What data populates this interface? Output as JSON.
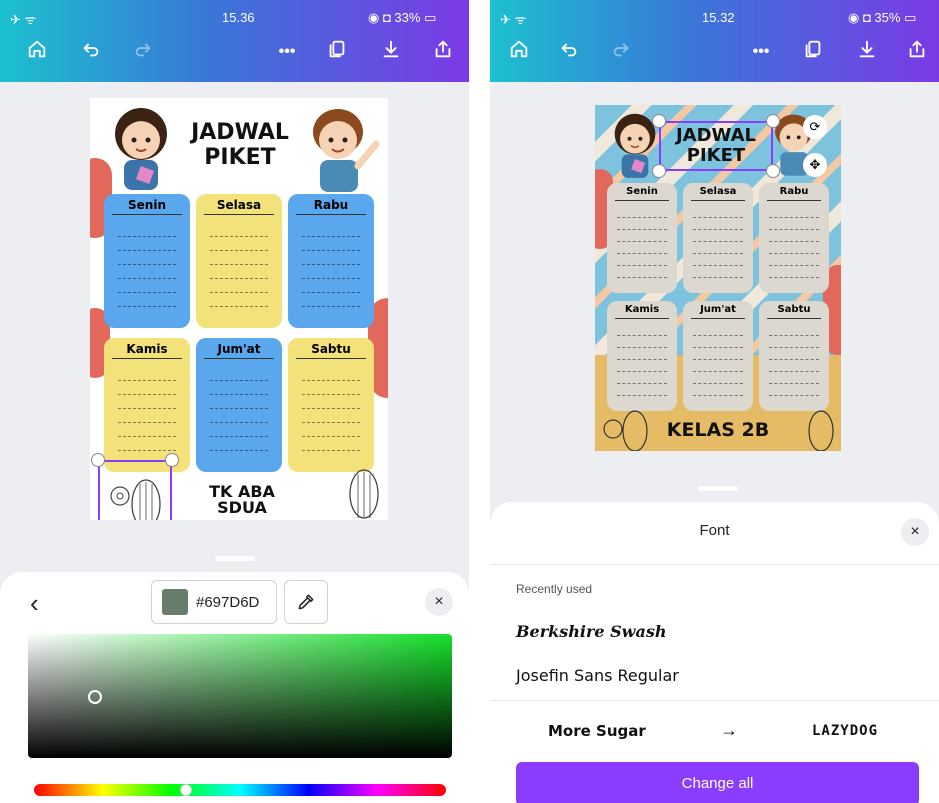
{
  "left": {
    "status": {
      "time": "15.36",
      "battery": "33%"
    },
    "toolbar": {
      "home": "home-icon",
      "undo": "undo-icon",
      "redo": "redo-icon",
      "more": "•••",
      "copy": "copy-icon",
      "download": "download-icon",
      "share": "share-icon"
    },
    "poster": {
      "title_line1": "JADWAL",
      "title_line2": "PIKET",
      "days": [
        "Senin",
        "Selasa",
        "Rabu",
        "Kamis",
        "Jum'at",
        "Sabtu"
      ],
      "footer": "TK ABA SDUA",
      "day_colors": [
        "#5aa7ee",
        "#f3e27a",
        "#5aa7ee",
        "#f3e27a",
        "#5aa7ee",
        "#f3e27a"
      ]
    },
    "color_panel": {
      "back": "‹",
      "hex": "#697D6D",
      "swatch_color": "#697D6D",
      "eyedropper": "eyedropper-icon",
      "close": "×"
    }
  },
  "right": {
    "status": {
      "time": "15.32",
      "battery": "35%"
    },
    "toolbar": {
      "home": "home-icon",
      "undo": "undo-icon",
      "redo": "redo-icon",
      "more": "•••",
      "copy": "copy-icon",
      "download": "download-icon",
      "share": "share-icon"
    },
    "poster": {
      "title_line1": "JADWAL",
      "title_line2": "PIKET",
      "days": [
        "Senin",
        "Selasa",
        "Rabu",
        "Kamis",
        "Jum'at",
        "Sabtu"
      ],
      "footer": "KELAS 2B",
      "day_color": "#dcd8cf"
    },
    "font_panel": {
      "title": "Font",
      "close": "×",
      "section": "Recently used",
      "fonts": [
        "Berkshire Swash",
        "Josefin Sans Regular"
      ],
      "replace_from": "More Sugar",
      "arrow": "→",
      "replace_to": "LAZYDOG",
      "change_all": "Change all"
    }
  }
}
